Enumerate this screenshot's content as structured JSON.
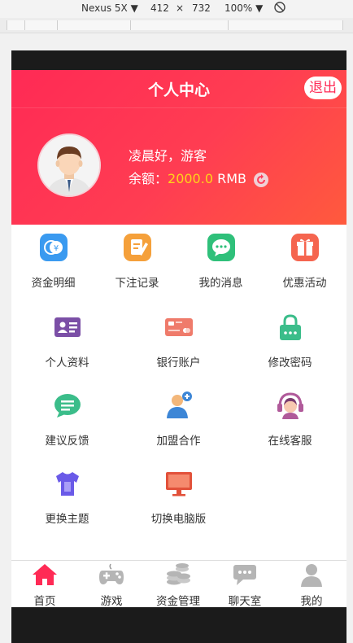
{
  "devtools": {
    "device": "Nexus 5X ▼",
    "width": "412",
    "times": "×",
    "height": "732",
    "zoom": "100% ▼"
  },
  "header": {
    "title": "个人中心",
    "logout_label": "退出"
  },
  "profile": {
    "greeting": "凌晨好，游客",
    "balance_label": "余额：",
    "balance_amount": "2000.0",
    "currency": "RMB"
  },
  "menu_row1": [
    {
      "label": "资金明细",
      "icon": "fund-detail-icon"
    },
    {
      "label": "下注记录",
      "icon": "bet-record-icon"
    },
    {
      "label": "我的消息",
      "icon": "message-icon"
    },
    {
      "label": "优惠活动",
      "icon": "gift-icon"
    }
  ],
  "menu_row2": [
    {
      "label": "个人资料",
      "icon": "id-card-icon"
    },
    {
      "label": "银行账户",
      "icon": "bank-card-icon"
    },
    {
      "label": "修改密码",
      "icon": "lock-icon"
    }
  ],
  "menu_row3": [
    {
      "label": "建议反馈",
      "icon": "feedback-icon"
    },
    {
      "label": "加盟合作",
      "icon": "add-user-icon"
    },
    {
      "label": "在线客服",
      "icon": "headset-icon"
    }
  ],
  "menu_row4": [
    {
      "label": "更换主题",
      "icon": "tshirt-icon"
    },
    {
      "label": "切换电脑版",
      "icon": "monitor-icon"
    }
  ],
  "bottom_nav": [
    {
      "label": "首页",
      "icon": "home-icon",
      "active": true
    },
    {
      "label": "游戏",
      "icon": "gamepad-icon"
    },
    {
      "label": "资金管理",
      "icon": "coins-icon"
    },
    {
      "label": "聊天室",
      "icon": "chat-icon"
    },
    {
      "label": "我的",
      "icon": "user-icon"
    }
  ],
  "colors": {
    "brand_red": "#ff2a55",
    "balance_yellow": "#ffd21a"
  }
}
